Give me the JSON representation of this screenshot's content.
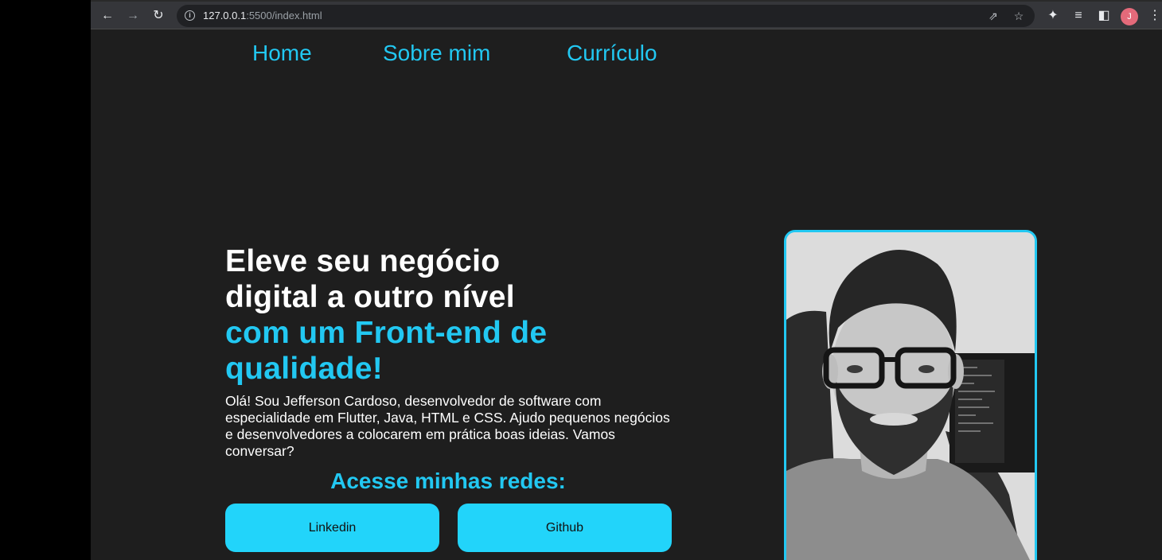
{
  "browser": {
    "url_host": "127.0.0.1",
    "url_path": ":5500/index.html",
    "profile_initial": "J"
  },
  "nav": {
    "items": [
      {
        "label": "Home"
      },
      {
        "label": "Sobre mim"
      },
      {
        "label": "Currículo"
      }
    ]
  },
  "hero": {
    "headline_line1": "Eleve seu negócio",
    "headline_line2": "digital a outro nível",
    "headline_accent_line1": "com um Front-end de",
    "headline_accent_line2": "qualidade!",
    "intro": "Olá! Sou Jefferson Cardoso, desenvolvedor de software com especialidade em Flutter, Java, HTML e CSS. Ajudo pequenos negócios e desenvolvedores a colocarem em prática boas ideias. Vamos conversar?",
    "social_title": "Acesse minhas redes:",
    "linkedin_label": "Linkedin",
    "github_label": "Github"
  },
  "colors": {
    "accent": "#22c8f2",
    "background": "#1e1e1e",
    "button": "#22d4fa"
  }
}
